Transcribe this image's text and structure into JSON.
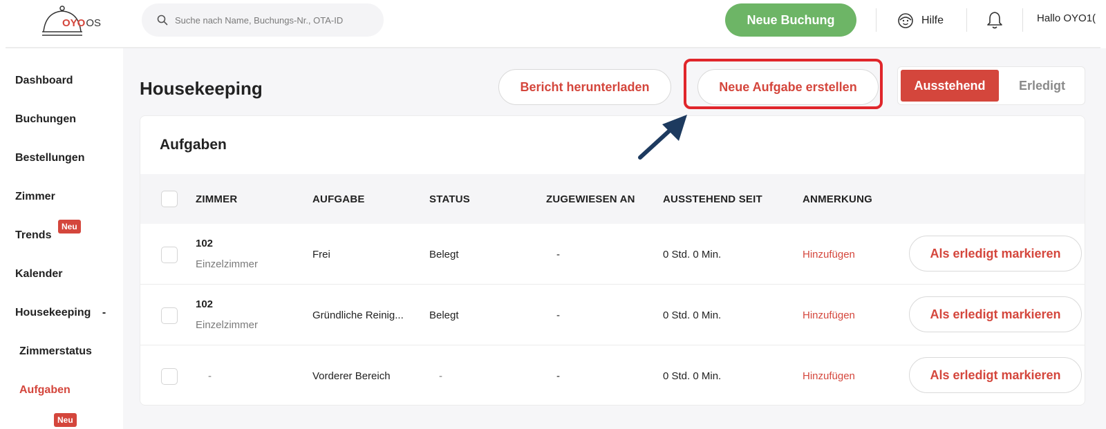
{
  "header": {
    "logo_brand": "OYO",
    "logo_suffix": "OS",
    "search_placeholder": "Suche nach Name, Buchungs-Nr., OTA-ID",
    "new_booking_label": "Neue Buchung",
    "help_label": "Hilfe",
    "greeting": "Hallo OYO1("
  },
  "sidebar": {
    "items": [
      {
        "label": "Dashboard"
      },
      {
        "label": "Buchungen"
      },
      {
        "label": "Bestellungen"
      },
      {
        "label": "Zimmer"
      },
      {
        "label": "Trends",
        "badge": "Neu"
      },
      {
        "label": "Kalender"
      },
      {
        "label": "Housekeeping",
        "suffix": "-"
      },
      {
        "label": "Zimmerstatus"
      },
      {
        "label": "Aufgaben"
      }
    ],
    "bottom_badge": "Neu"
  },
  "page": {
    "title": "Housekeeping",
    "download_report_label": "Bericht herunterladen",
    "create_task_label": "Neue Aufgabe erstellen",
    "tabs": [
      {
        "label": "Ausstehend",
        "active": true
      },
      {
        "label": "Erledigt",
        "active": false
      }
    ]
  },
  "tasks": {
    "title": "Aufgaben",
    "columns": [
      "ZIMMER",
      "AUFGABE",
      "STATUS",
      "ZUGEWIESEN AN",
      "AUSSTEHEND SEIT",
      "ANMERKUNG"
    ],
    "rows": [
      {
        "room": "102",
        "room_type": "Einzelzimmer",
        "task": "Frei",
        "status": "Belegt",
        "assigned": "-",
        "pending": "0 Std. 0 Min.",
        "note": "Hinzufügen",
        "action": "Als erledigt markieren"
      },
      {
        "room": "102",
        "room_type": "Einzelzimmer",
        "task": "Gründliche Reinig...",
        "status": "Belegt",
        "assigned": "-",
        "pending": "0 Std. 0 Min.",
        "note": "Hinzufügen",
        "action": "Als erledigt markieren"
      },
      {
        "room": "-",
        "room_type": "",
        "task": "Vorderer Bereich",
        "status": "-",
        "assigned": "-",
        "pending": "0 Std. 0 Min.",
        "note": "Hinzufügen",
        "action": "Als erledigt markieren"
      }
    ]
  },
  "colors": {
    "accent_red": "#d4463c",
    "brand_green": "#6db566",
    "highlight_red": "#e0262b",
    "arrow_navy": "#1d3a5f"
  }
}
